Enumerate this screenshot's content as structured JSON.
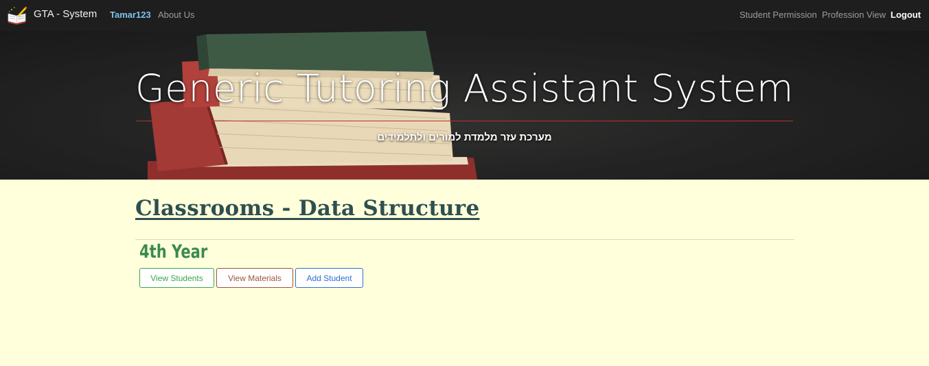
{
  "navbar": {
    "brand": "GTA - System",
    "user": "Tamar123",
    "about": "About Us",
    "student_permission": "Student Permission",
    "profession_view": "Profession View",
    "logout": "Logout"
  },
  "hero": {
    "title": "Generic Tutoring Assistant System",
    "subtitle": "מערכת עזר מלמדת למורים ולתלמידים"
  },
  "main": {
    "title": "Classrooms - Data Structure",
    "year": "4th Year",
    "buttons": {
      "view_students": "View Students",
      "view_materials": "View Materials",
      "add_student": "Add Student"
    }
  },
  "colors": {
    "navbar_bg": "#1e1e1e",
    "page_bg": "#ffffdc",
    "title": "#2f4f4f",
    "year": "#3a8a4e",
    "view_students": "#3aa64a",
    "view_materials": "#a0523d",
    "add_student": "#2d6fd1"
  },
  "icons": {
    "brand_logo": "book-pencil-icon"
  }
}
